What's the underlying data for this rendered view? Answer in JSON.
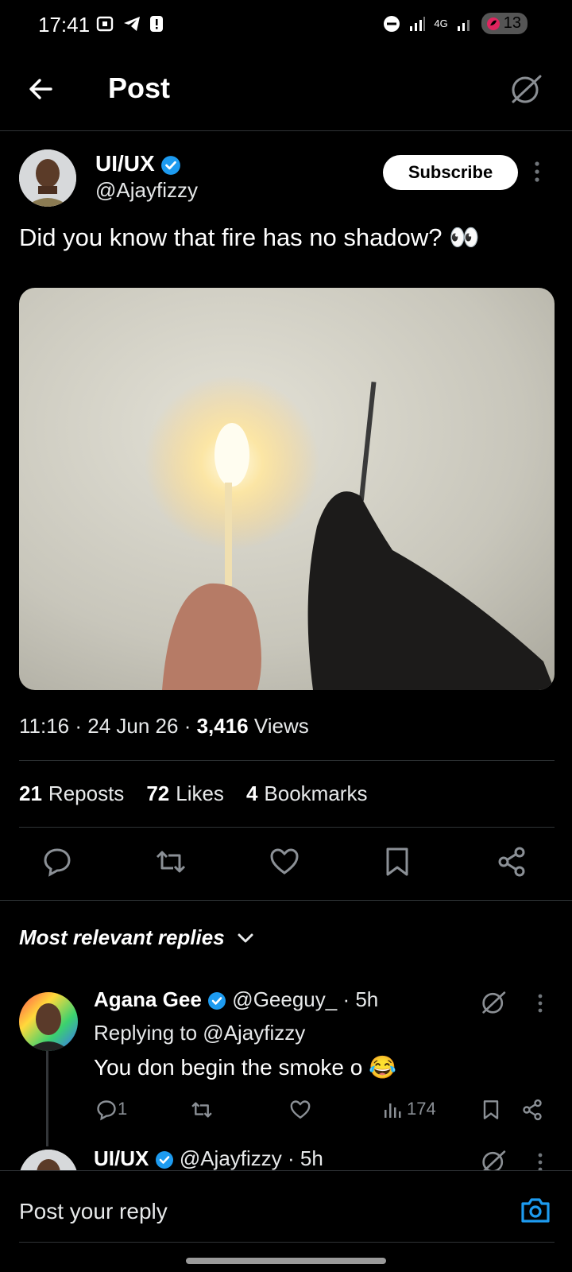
{
  "status_bar": {
    "time": "17:41",
    "network": "4G",
    "battery": "13"
  },
  "header": {
    "title": "Post"
  },
  "post": {
    "author_name": "UI/UX",
    "author_handle": "@Ajayfizzy",
    "subscribe_label": "Subscribe",
    "text": "Did you know that fire has no shadow? 👀",
    "meta_time": "11:16",
    "meta_date": "24 Jun 26",
    "views_count": "3,416",
    "views_label": "Views",
    "reposts_count": "21",
    "reposts_label": "Reposts",
    "likes_count": "72",
    "likes_label": "Likes",
    "bookmarks_count": "4",
    "bookmarks_label": "Bookmarks"
  },
  "replies_header": {
    "label": "Most relevant replies"
  },
  "replies": [
    {
      "name": "Agana Gee",
      "handle": "@Geeguy_",
      "time": "5h",
      "replying_to": "Replying to @Ajayfizzy",
      "text": "You don begin the smoke o 😂",
      "reply_count": "1",
      "views": "174"
    },
    {
      "name": "UI/UX",
      "handle": "@Ajayfizzy",
      "time": "5h"
    }
  ],
  "composer": {
    "placeholder": "Post your reply"
  },
  "colors": {
    "accent": "#1d9bf0",
    "background": "#000000",
    "divider": "#2f3336"
  }
}
